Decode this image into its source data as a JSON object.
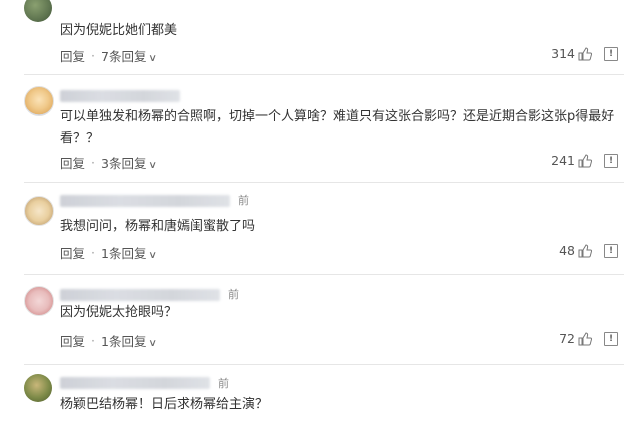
{
  "comments": [
    {
      "text": "因为倪妮比她们都美",
      "reply_label": "回复",
      "replies_label": "7条回复",
      "likes": "314"
    },
    {
      "text": "可以单独发和杨幂的合照啊，切掉一个人算啥？难道只有这张合影吗？还是近期合影这张p得最好看？？",
      "reply_label": "回复",
      "replies_label": "3条回复",
      "likes": "241"
    },
    {
      "time_fragment": "前",
      "text": "我想问问，杨幂和唐嫣闺蜜散了吗",
      "reply_label": "回复",
      "replies_label": "1条回复",
      "likes": "48"
    },
    {
      "time_fragment": "前",
      "text": "因为倪妮太抢眼吗？",
      "reply_label": "回复",
      "replies_label": "1条回复",
      "likes": "72"
    },
    {
      "time_fragment": "前",
      "text": "杨颖巴结杨幂！日后求杨幂给主演？"
    }
  ],
  "icons": {
    "like": "thumbs-up-icon",
    "report": "report-icon",
    "expand": "chevron-down-icon"
  },
  "report_glyph": "!",
  "chevron_glyph": "∨"
}
